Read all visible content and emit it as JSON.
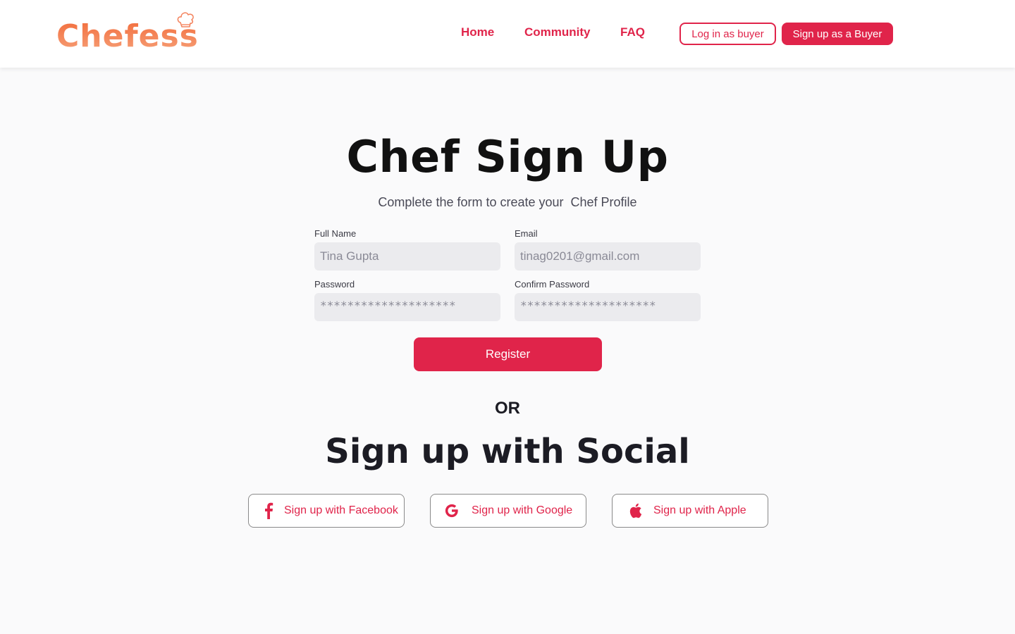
{
  "brand": {
    "name": "Chefess",
    "primary_color": "#e0244a",
    "logo_color": "#f4845f",
    "hat_icon": "chef-hat-icon"
  },
  "nav": {
    "links": [
      "Home",
      "Community",
      "FAQ"
    ],
    "login_label": "Log in as buyer",
    "signup_label": "Sign up as a Buyer"
  },
  "form": {
    "title": "Chef Sign Up",
    "subtitle": "Complete the form to create your  Chef Profile",
    "full_name": {
      "label": "Full Name",
      "value": "Tina Gupta"
    },
    "email": {
      "label": "Email",
      "value": "tinag0201@gmail.com"
    },
    "password": {
      "label": "Password",
      "value": "********************"
    },
    "confirm_password": {
      "label": "Confirm Password",
      "value": "********************"
    },
    "register_label": "Register"
  },
  "divider_text": "OR",
  "social": {
    "title": "Sign up with Social",
    "buttons": [
      {
        "label": "Sign up with Facebook",
        "icon": "facebook-icon"
      },
      {
        "label": "Sign up with Google",
        "icon": "google-icon"
      },
      {
        "label": "Sign up with Apple",
        "icon": "apple-icon"
      }
    ]
  }
}
